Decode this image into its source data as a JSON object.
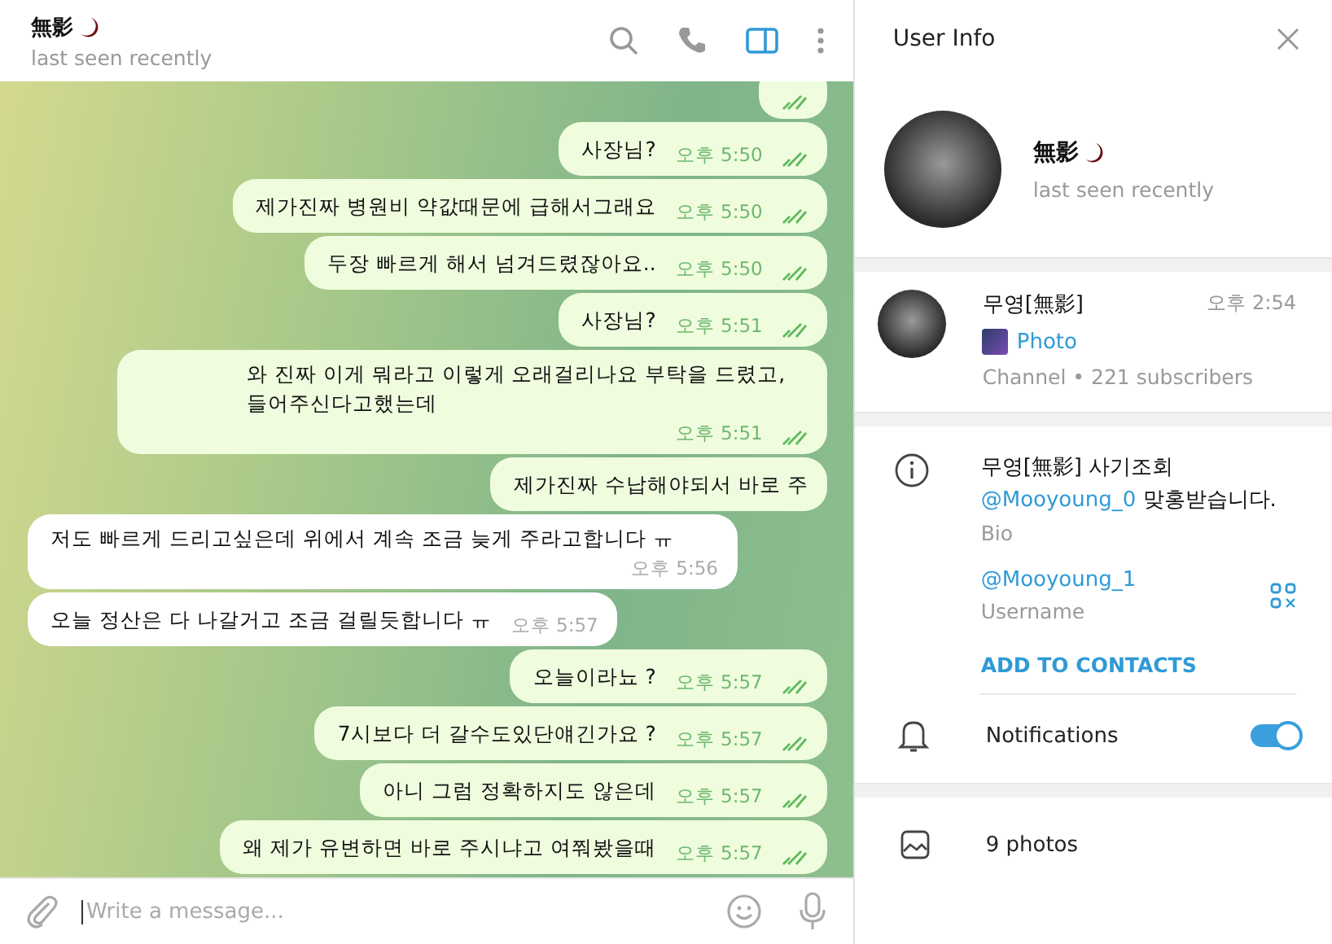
{
  "chat_header": {
    "name": "無影",
    "status": "last seen recently",
    "side_panel_open": true
  },
  "messages": [
    {
      "kind": "out",
      "read": true
    },
    {
      "kind": "out",
      "text": "사장님?",
      "time": "오후 5:50",
      "read": true
    },
    {
      "kind": "out",
      "text": "제가진짜 병원비 약값때문에 급해서그래요",
      "time": "오후 5:50",
      "read": true
    },
    {
      "kind": "out",
      "text": "두장 빠르게 해서 넘겨드렸잖아요..",
      "time": "오후 5:50",
      "read": true
    },
    {
      "kind": "out",
      "text": "사장님?",
      "time": "오후 5:51",
      "read": true
    },
    {
      "kind": "out",
      "text": "와 진짜 이게 뭐라고 이렇게 오래걸리나요 부탁을 드렸고, 들어주신다고했는데",
      "time": "오후 5:51",
      "read": true
    },
    {
      "kind": "out",
      "text": "제가진짜 수납해야되서 바로 주",
      "read": false
    },
    {
      "kind": "in",
      "text": "저도 빠르게 드리고싶은데 위에서 계속 조금 늦게 주라고합니다 ㅠ",
      "time": "오후 5:56"
    },
    {
      "kind": "in",
      "text": "오늘 정산은 다 나갈거고 조금 걸릴듯합니다 ㅠ",
      "time": "오후 5:57"
    },
    {
      "kind": "out",
      "text": "오늘이라뇨 ?",
      "time": "오후 5:57",
      "read": true
    },
    {
      "kind": "out",
      "text": "7시보다 더 갈수도있단얘긴가요 ?",
      "time": "오후 5:57",
      "read": true
    },
    {
      "kind": "out",
      "text": "아니 그럼 정확하지도 않은데",
      "time": "오후 5:57",
      "read": true
    },
    {
      "kind": "out",
      "text": "왜 제가 유변하면 바로 주시냐고 여쭤봤을때",
      "time": "오후 5:57",
      "read": true
    }
  ],
  "composer": {
    "placeholder": "Write a message..."
  },
  "user_info": {
    "title": "User Info",
    "name": "無影",
    "status": "last seen recently",
    "channel": {
      "name": "무영[無影]",
      "time": "오후 2:54",
      "preview": "Photo",
      "meta": "Channel • 221 subscribers"
    },
    "bio": {
      "line_1": "무영[無影] 사기조회",
      "link": "@Mooyoung_0",
      "rest": " 맞홍받습니다.",
      "label": "Bio"
    },
    "username": {
      "value": "@Mooyoung_1",
      "label": "Username"
    },
    "add_contact": "ADD TO CONTACTS",
    "notifications": {
      "label": "Notifications",
      "on": true
    },
    "media": "9 photos"
  }
}
